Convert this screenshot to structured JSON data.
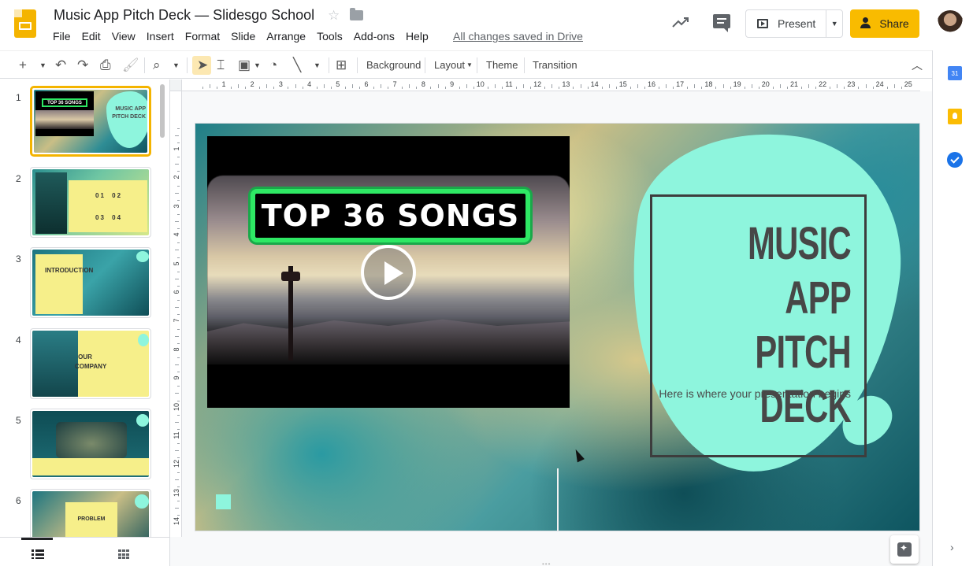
{
  "app": {
    "doc_title": "Music App Pitch Deck — Slidesgo School",
    "saved_status": "All changes saved in Drive",
    "menu": [
      "File",
      "Edit",
      "View",
      "Insert",
      "Format",
      "Slide",
      "Arrange",
      "Tools",
      "Add-ons",
      "Help"
    ],
    "present_label": "Present",
    "share_label": "Share"
  },
  "toolbar": {
    "background_label": "Background",
    "layout_label": "Layout",
    "theme_label": "Theme",
    "transition_label": "Transition"
  },
  "filmstrip": {
    "slides": [
      {
        "num": "1",
        "label": "MUSIC APP PITCH DECK",
        "video_label": "TOP 36 SONGS"
      },
      {
        "num": "2",
        "label": "01 02 03 04"
      },
      {
        "num": "3",
        "label": "INTRODUCTION"
      },
      {
        "num": "4",
        "label": "OUR COMPANY"
      },
      {
        "num": "5",
        "label": ""
      },
      {
        "num": "6",
        "label": "PROBLEM"
      }
    ],
    "selected": 1
  },
  "ruler": {
    "horizontal": [
      "1",
      "2",
      "3",
      "4",
      "5",
      "6",
      "7",
      "8",
      "9",
      "10",
      "11",
      "12",
      "13",
      "14",
      "15",
      "16",
      "17",
      "18",
      "19",
      "20",
      "21",
      "22",
      "23",
      "24",
      "25"
    ],
    "vertical": [
      "1",
      "2",
      "3",
      "4",
      "5",
      "6",
      "7",
      "8",
      "9",
      "10",
      "11",
      "12",
      "13",
      "14"
    ]
  },
  "slide": {
    "video_title": "TOP 36 SONGS",
    "title_line1": "MUSIC",
    "title_line2": "APP PITCH",
    "title_line3": "DECK",
    "subtitle": "Here is where your presentation begins"
  },
  "side_panel": {
    "calendar_day": "31"
  },
  "colors": {
    "accent_yellow": "#f9bb00",
    "mint": "#8ef5dd",
    "neon_green": "#2ee864"
  }
}
